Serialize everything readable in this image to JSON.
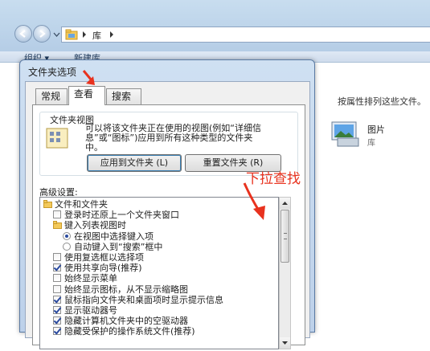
{
  "explorer": {
    "address_path": "库",
    "toolbar": {
      "organize": "组织 ▾",
      "new_library": "新建库"
    },
    "library_description": "按属性排列这些文件。",
    "pictures_label": "图片",
    "pictures_sub": "库"
  },
  "dialog": {
    "title": "文件夹选项",
    "tabs": [
      "常规",
      "查看",
      "搜索"
    ],
    "folder_view_group": "文件夹视图",
    "folder_view_description": "可以将该文件夹正在使用的视图(例如“详细信\n息”或“图标”)应用到所有这种类型的文件夹\n中。",
    "apply_button": "应用到文件夹 (L)",
    "reset_button": "重置文件夹 (R)",
    "advanced_label": "高级设置:",
    "tree_items": [
      {
        "label": "文件和文件夹",
        "kind": "folder",
        "checked": false,
        "indent": 0
      },
      {
        "label": "登录时还原上一个文件夹窗口",
        "kind": "checkbox",
        "checked": false,
        "indent": 1
      },
      {
        "label": "键入列表视图时",
        "kind": "folder",
        "checked": false,
        "indent": 1
      },
      {
        "label": "在视图中选择键入项",
        "kind": "radio",
        "checked": true,
        "indent": 2
      },
      {
        "label": "自动键入到“搜索”框中",
        "kind": "radio",
        "checked": false,
        "indent": 2
      },
      {
        "label": "使用复选框以选择项",
        "kind": "checkbox",
        "checked": false,
        "indent": 1
      },
      {
        "label": "使用共享向导(推荐)",
        "kind": "checkbox",
        "checked": true,
        "indent": 1
      },
      {
        "label": "始终显示菜单",
        "kind": "checkbox",
        "checked": false,
        "indent": 1
      },
      {
        "label": "始终显示图标，从不显示缩略图",
        "kind": "checkbox",
        "checked": false,
        "indent": 1
      },
      {
        "label": "鼠标指向文件夹和桌面项时显示提示信息",
        "kind": "checkbox",
        "checked": true,
        "indent": 1
      },
      {
        "label": "显示驱动器号",
        "kind": "checkbox",
        "checked": true,
        "indent": 1
      },
      {
        "label": "隐藏计算机文件夹中的空驱动器",
        "kind": "checkbox",
        "checked": true,
        "indent": 1
      },
      {
        "label": "隐藏受保护的操作系统文件(推荐)",
        "kind": "checkbox",
        "checked": true,
        "indent": 1
      }
    ]
  },
  "annotation": {
    "text": "下拉查找",
    "color": "#e8321e"
  }
}
